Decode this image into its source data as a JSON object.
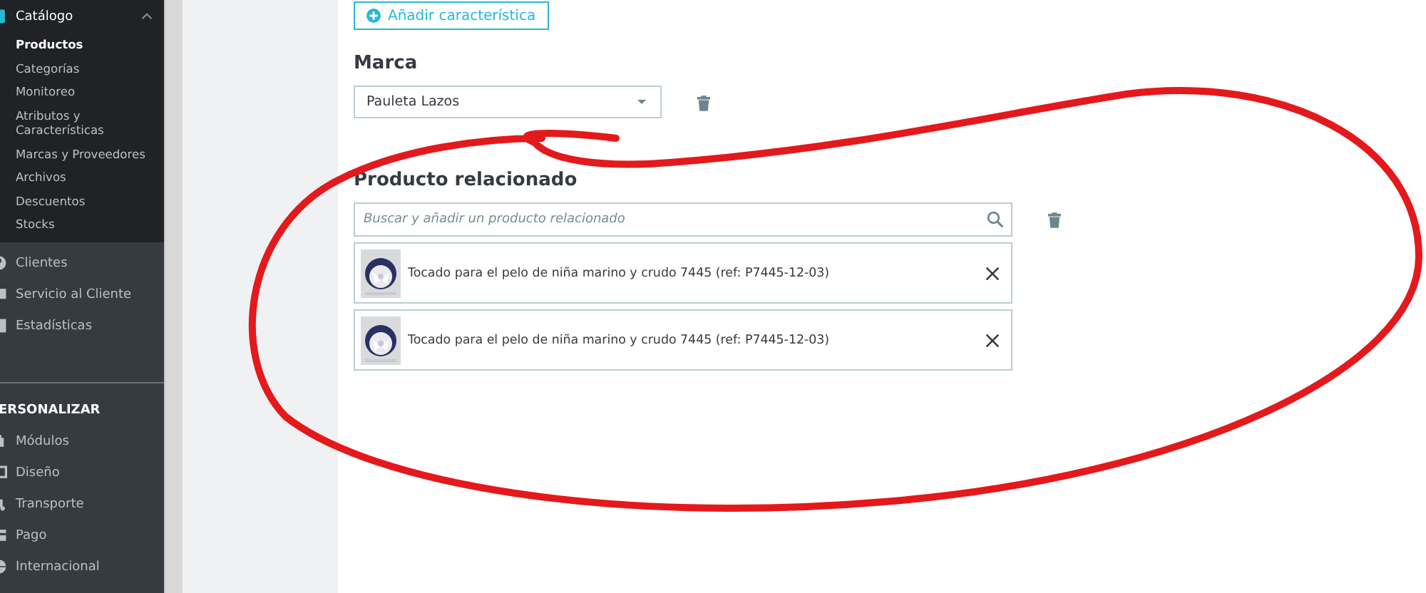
{
  "sidebar": {
    "items": [
      {
        "label": "Catálogo",
        "expanded": true,
        "children": [
          {
            "label": "Productos",
            "selected": true
          },
          {
            "label": "Categorías",
            "selected": false
          },
          {
            "label": "Monitoreo",
            "selected": false
          },
          {
            "label": "Atributos y Características",
            "selected": false
          },
          {
            "label": "Marcas y Proveedores",
            "selected": false
          },
          {
            "label": "Archivos",
            "selected": false
          },
          {
            "label": "Descuentos",
            "selected": false
          },
          {
            "label": "Stocks",
            "selected": false
          }
        ]
      },
      {
        "label": "Clientes"
      },
      {
        "label": "Servicio al Cliente"
      },
      {
        "label": "Estadísticas"
      }
    ],
    "section": {
      "title": "ERSONALIZAR",
      "items": [
        {
          "label": "Módulos"
        },
        {
          "label": "Diseño"
        },
        {
          "label": "Transporte"
        },
        {
          "label": "Pago"
        },
        {
          "label": "Internacional"
        }
      ]
    }
  },
  "add_feature_button": "Añadir característica",
  "brand": {
    "heading": "Marca",
    "value": "Pauleta Lazos"
  },
  "related": {
    "heading": "Producto relacionado",
    "placeholder": "Buscar y añadir un producto relacionado",
    "products": [
      {
        "name": "Tocado para el pelo de niña marino y crudo 7445 (ref: P7445-12-03)"
      },
      {
        "name": "Tocado para el pelo de niña marino y crudo 7445 (ref: P7445-12-03)"
      }
    ]
  }
}
